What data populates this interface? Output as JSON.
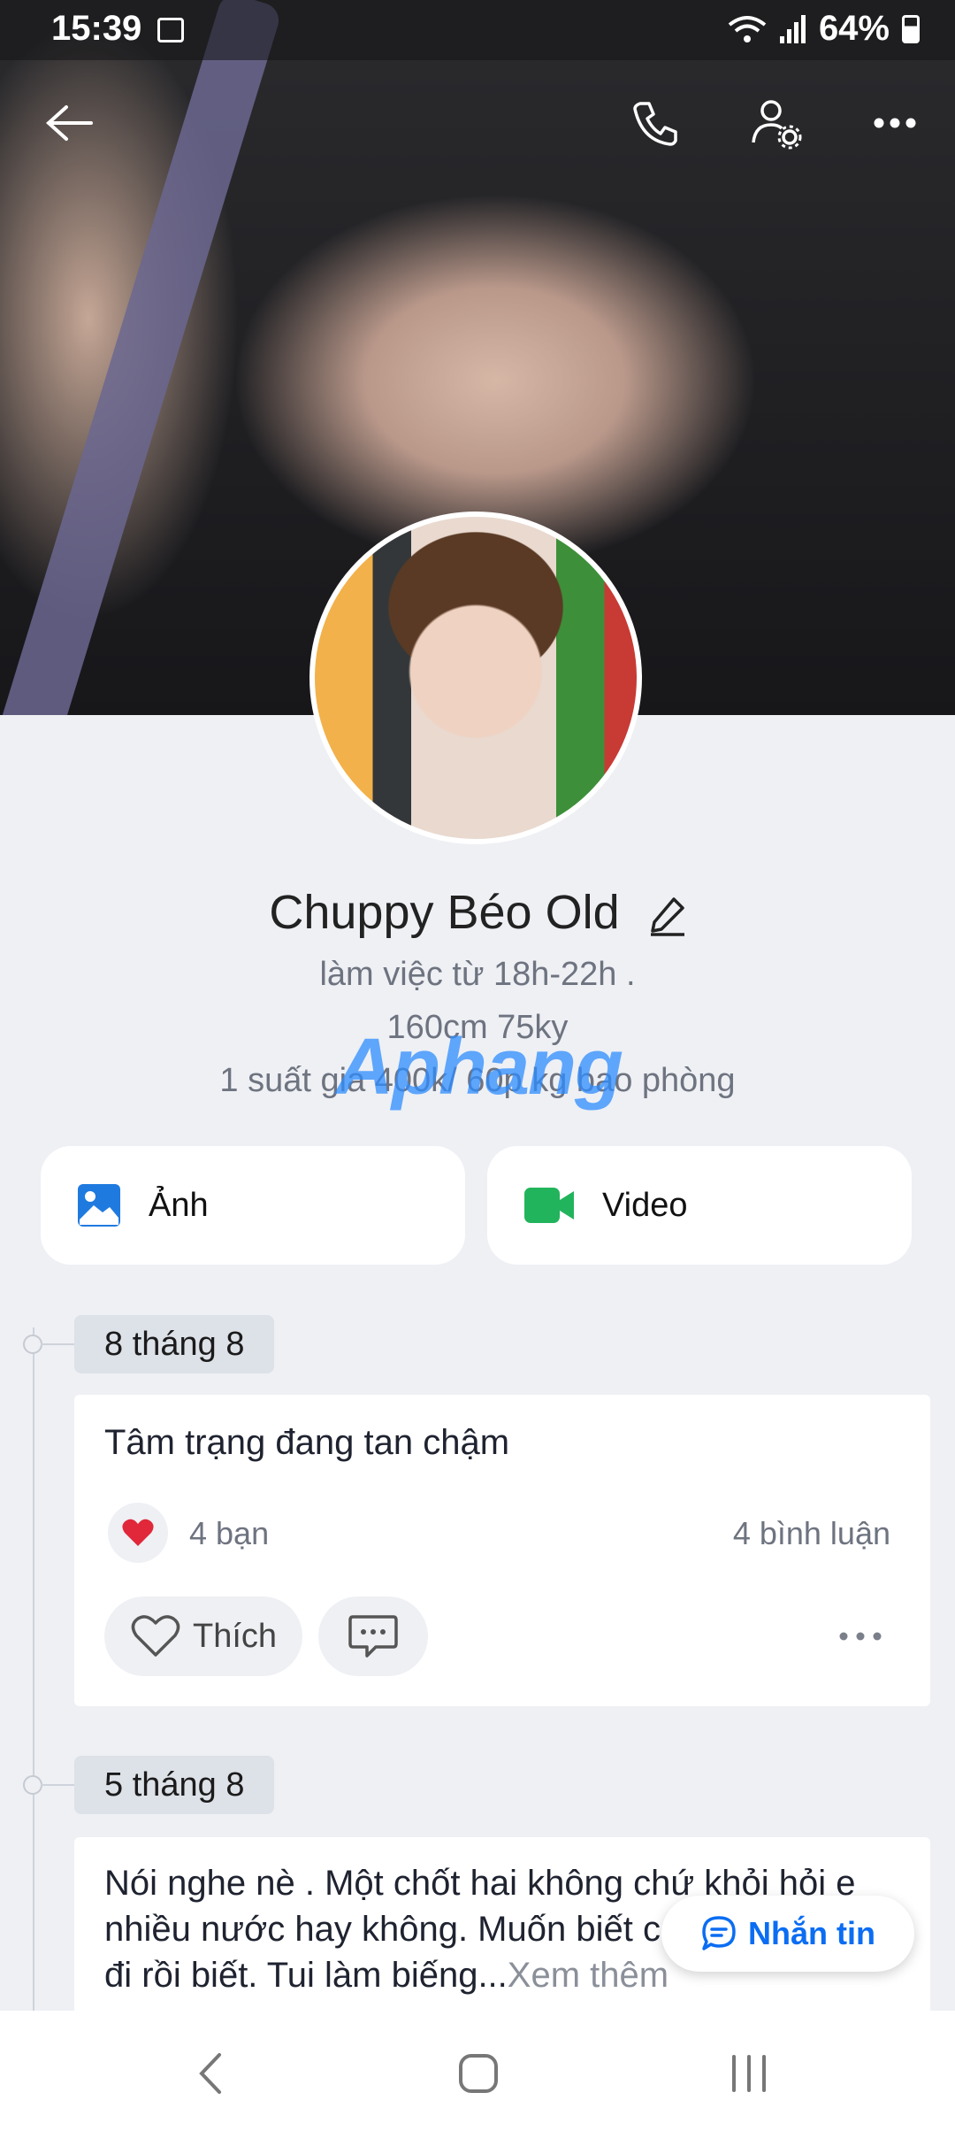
{
  "status": {
    "time": "15:39",
    "battery": "64%"
  },
  "profile": {
    "name": "Chuppy Béo Old",
    "bio_lines": [
      "làm việc từ 18h-22h .",
      "160cm 75ky",
      "1 suất gia 400k/ 60p kg bao phòng"
    ],
    "watermark": "Aphang"
  },
  "media": {
    "photos_label": "Ảnh",
    "video_label": "Video"
  },
  "posts": [
    {
      "date": "8 tháng 8",
      "text": "Tâm trạng đang tan chậm",
      "reactions": "4 bạn",
      "comments": "4 bình luận",
      "like_label": "Thích"
    },
    {
      "date": "5 tháng 8",
      "text_line1": "Nói nghe nè . Một chốt hai không chứ khỏi hỏi e",
      "text_line2": "nhiều nước hay không. Muốn biết c",
      "text_line3": "đi rồi biết. Tui làm biếng...",
      "more": "Xem thêm"
    }
  ],
  "message_button": "Nhắn tin",
  "colors": {
    "accent": "#0b6df2",
    "heart": "#e0283a"
  }
}
